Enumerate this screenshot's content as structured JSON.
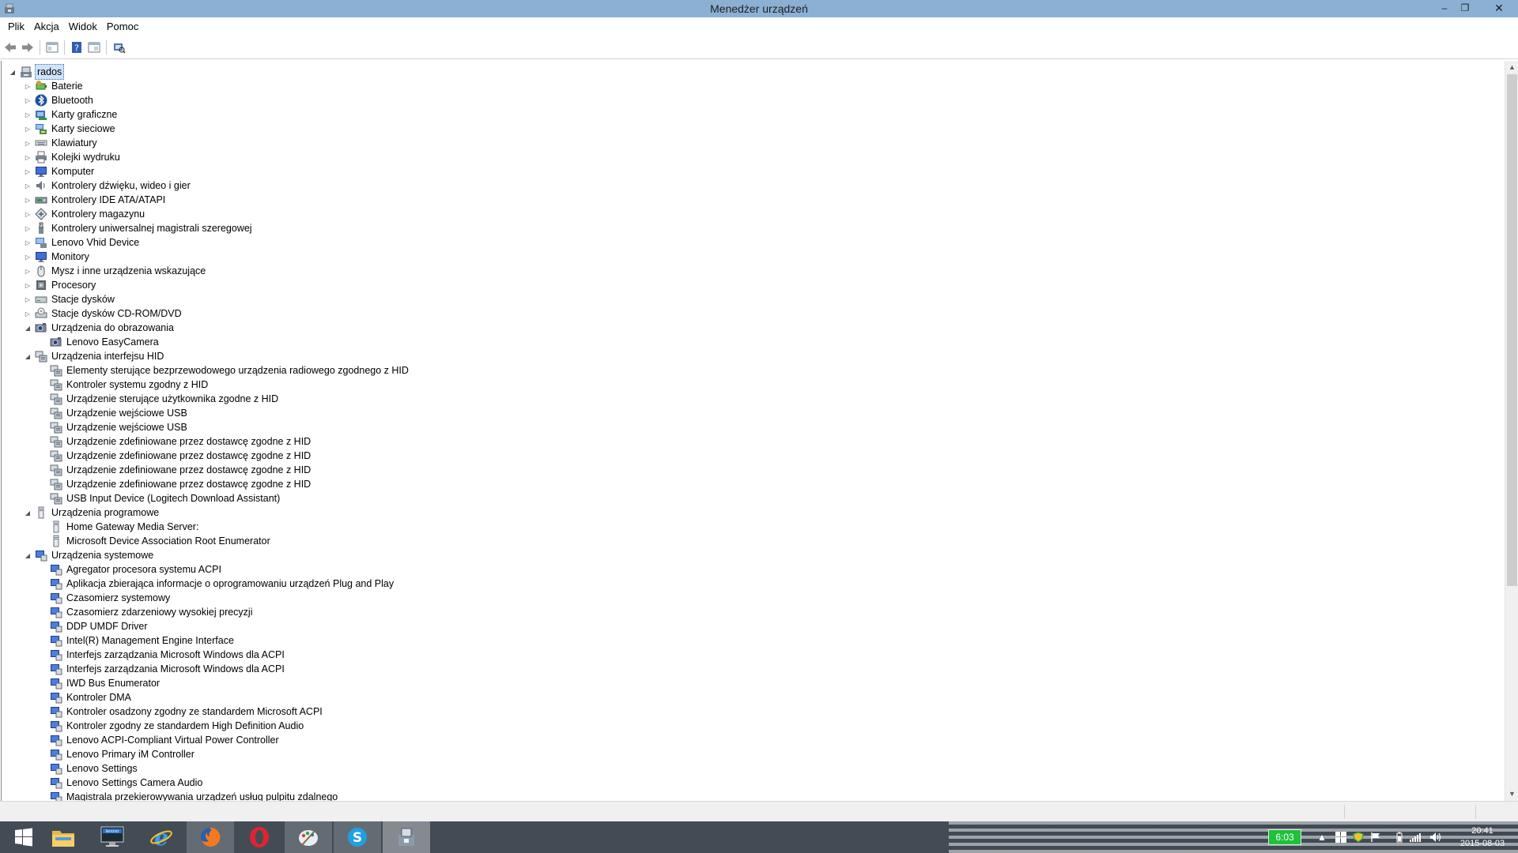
{
  "window": {
    "title": "Menedżer urządzeń",
    "controls": {
      "minimize": "–",
      "restore": "❐",
      "close": "✕"
    }
  },
  "menu": [
    "Plik",
    "Akcja",
    "Widok",
    "Pomoc"
  ],
  "toolbar_icons": [
    "back-arrow-icon",
    "forward-arrow-icon",
    "properties-view-icon",
    "help-icon",
    "console-tree-icon",
    "scan-hardware-icon"
  ],
  "tree": [
    {
      "label": "rados",
      "level": 0,
      "state": "expanded",
      "icon": "computer-icon",
      "selected": true
    },
    {
      "label": "Baterie",
      "level": 1,
      "state": "collapsed",
      "icon": "battery-icon"
    },
    {
      "label": "Bluetooth",
      "level": 1,
      "state": "collapsed",
      "icon": "bluetooth-icon"
    },
    {
      "label": "Karty graficzne",
      "level": 1,
      "state": "collapsed",
      "icon": "display-adapter-icon"
    },
    {
      "label": "Karty sieciowe",
      "level": 1,
      "state": "collapsed",
      "icon": "network-adapter-icon"
    },
    {
      "label": "Klawiatury",
      "level": 1,
      "state": "collapsed",
      "icon": "keyboard-icon"
    },
    {
      "label": "Kolejki wydruku",
      "level": 1,
      "state": "collapsed",
      "icon": "printer-icon"
    },
    {
      "label": "Komputer",
      "level": 1,
      "state": "collapsed",
      "icon": "monitor-icon"
    },
    {
      "label": "Kontrolery dźwięku, wideo i gier",
      "level": 1,
      "state": "collapsed",
      "icon": "speaker-icon"
    },
    {
      "label": "Kontrolery IDE ATA/ATAPI",
      "level": 1,
      "state": "collapsed",
      "icon": "ide-controller-icon"
    },
    {
      "label": "Kontrolery magazynu",
      "level": 1,
      "state": "collapsed",
      "icon": "storage-controller-icon"
    },
    {
      "label": "Kontrolery uniwersalnej magistrali szeregowej",
      "level": 1,
      "state": "collapsed",
      "icon": "usb-icon"
    },
    {
      "label": "Lenovo Vhid Device",
      "level": 1,
      "state": "collapsed",
      "icon": "vhid-device-icon"
    },
    {
      "label": "Monitory",
      "level": 1,
      "state": "collapsed",
      "icon": "monitor-icon"
    },
    {
      "label": "Mysz i inne urządzenia wskazujące",
      "level": 1,
      "state": "collapsed",
      "icon": "mouse-icon"
    },
    {
      "label": "Procesory",
      "level": 1,
      "state": "collapsed",
      "icon": "processor-icon"
    },
    {
      "label": "Stacje dysków",
      "level": 1,
      "state": "collapsed",
      "icon": "disk-drive-icon"
    },
    {
      "label": "Stacje dysków CD-ROM/DVD",
      "level": 1,
      "state": "collapsed",
      "icon": "cdrom-icon"
    },
    {
      "label": "Urządzenia do obrazowania",
      "level": 1,
      "state": "expanded",
      "icon": "camera-icon"
    },
    {
      "label": "Lenovo EasyCamera",
      "level": 2,
      "state": "leaf",
      "icon": "camera-icon"
    },
    {
      "label": "Urządzenia interfejsu HID",
      "level": 1,
      "state": "expanded",
      "icon": "hid-icon"
    },
    {
      "label": "Elementy sterujące bezprzewodowego urządzenia radiowego zgodnego z HID",
      "level": 2,
      "state": "leaf",
      "icon": "hid-icon"
    },
    {
      "label": "Kontroler systemu zgodny z HID",
      "level": 2,
      "state": "leaf",
      "icon": "hid-icon"
    },
    {
      "label": "Urządzenie sterujące użytkownika zgodne z HID",
      "level": 2,
      "state": "leaf",
      "icon": "hid-icon"
    },
    {
      "label": "Urządzenie wejściowe USB",
      "level": 2,
      "state": "leaf",
      "icon": "hid-icon"
    },
    {
      "label": "Urządzenie wejściowe USB",
      "level": 2,
      "state": "leaf",
      "icon": "hid-icon"
    },
    {
      "label": "Urządzenie zdefiniowane przez dostawcę zgodne z HID",
      "level": 2,
      "state": "leaf",
      "icon": "hid-icon"
    },
    {
      "label": "Urządzenie zdefiniowane przez dostawcę zgodne z HID",
      "level": 2,
      "state": "leaf",
      "icon": "hid-icon"
    },
    {
      "label": "Urządzenie zdefiniowane przez dostawcę zgodne z HID",
      "level": 2,
      "state": "leaf",
      "icon": "hid-icon"
    },
    {
      "label": "Urządzenie zdefiniowane przez dostawcę zgodne z HID",
      "level": 2,
      "state": "leaf",
      "icon": "hid-icon"
    },
    {
      "label": "USB Input Device (Logitech Download Assistant)",
      "level": 2,
      "state": "leaf",
      "icon": "hid-icon"
    },
    {
      "label": "Urządzenia programowe",
      "level": 1,
      "state": "expanded",
      "icon": "software-device-icon"
    },
    {
      "label": "Home Gateway Media Server:",
      "level": 2,
      "state": "leaf",
      "icon": "software-device-icon"
    },
    {
      "label": "Microsoft Device Association Root Enumerator",
      "level": 2,
      "state": "leaf",
      "icon": "software-device-icon"
    },
    {
      "label": "Urządzenia systemowe",
      "level": 1,
      "state": "expanded",
      "icon": "system-device-icon"
    },
    {
      "label": "Agregator procesora systemu ACPI",
      "level": 2,
      "state": "leaf",
      "icon": "system-device-icon"
    },
    {
      "label": "Aplikacja zbierająca informacje o oprogramowaniu urządzeń Plug and Play",
      "level": 2,
      "state": "leaf",
      "icon": "system-device-icon"
    },
    {
      "label": "Czasomierz systemowy",
      "level": 2,
      "state": "leaf",
      "icon": "system-device-icon"
    },
    {
      "label": "Czasomierz zdarzeniowy wysokiej precyzji",
      "level": 2,
      "state": "leaf",
      "icon": "system-device-icon"
    },
    {
      "label": "DDP UMDF Driver",
      "level": 2,
      "state": "leaf",
      "icon": "system-device-icon"
    },
    {
      "label": "Intel(R) Management Engine Interface",
      "level": 2,
      "state": "leaf",
      "icon": "system-device-icon"
    },
    {
      "label": "Interfejs zarządzania Microsoft Windows dla ACPI",
      "level": 2,
      "state": "leaf",
      "icon": "system-device-icon"
    },
    {
      "label": "Interfejs zarządzania Microsoft Windows dla ACPI",
      "level": 2,
      "state": "leaf",
      "icon": "system-device-icon"
    },
    {
      "label": "IWD Bus Enumerator",
      "level": 2,
      "state": "leaf",
      "icon": "system-device-icon"
    },
    {
      "label": "Kontroler DMA",
      "level": 2,
      "state": "leaf",
      "icon": "system-device-icon"
    },
    {
      "label": "Kontroler osadzony zgodny ze standardem Microsoft ACPI",
      "level": 2,
      "state": "leaf",
      "icon": "system-device-icon"
    },
    {
      "label": "Kontroler zgodny ze standardem High Definition Audio",
      "level": 2,
      "state": "leaf",
      "icon": "system-device-icon"
    },
    {
      "label": "Lenovo ACPI-Compliant Virtual Power Controller",
      "level": 2,
      "state": "leaf",
      "icon": "system-device-icon"
    },
    {
      "label": "Lenovo Primary iM Controller",
      "level": 2,
      "state": "leaf",
      "icon": "system-device-icon"
    },
    {
      "label": "Lenovo Settings",
      "level": 2,
      "state": "leaf",
      "icon": "system-device-icon"
    },
    {
      "label": "Lenovo Settings Camera Audio",
      "level": 2,
      "state": "leaf",
      "icon": "system-device-icon"
    },
    {
      "label": "Magistrala przekierowywania urządzeń usług pulpitu zdalnego",
      "level": 2,
      "state": "leaf",
      "icon": "system-device-icon"
    }
  ],
  "taskbar": {
    "apps": [
      "start-button",
      "file-explorer-icon",
      "lenovo-app-icon",
      "internet-explorer-icon",
      "firefox-icon",
      "opera-icon",
      "paint-icon",
      "skype-icon",
      "device-manager-icon"
    ],
    "battery_time": "6:03",
    "clock_time": "20:41",
    "clock_date": "2015-08-03"
  },
  "colors": {
    "titlebar": "#8bb0d4",
    "selection": "#cfe3fb",
    "taskbar": "#434c55",
    "battery": "#1fc13a"
  }
}
